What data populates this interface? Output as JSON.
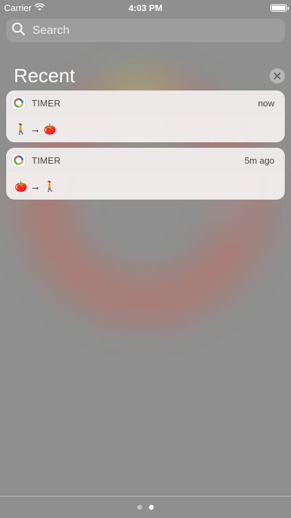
{
  "status_bar": {
    "carrier": "Carrier",
    "time": "4:03 PM"
  },
  "search": {
    "placeholder": "Search"
  },
  "recent": {
    "title": "Recent"
  },
  "notifications": [
    {
      "app": "TIMER",
      "time": "now",
      "message": "🚶 → 🍅"
    },
    {
      "app": "TIMER",
      "time": "5m ago",
      "message": "🍅 → 🚶"
    }
  ],
  "page_indicator": {
    "count": 2,
    "active": 2
  }
}
